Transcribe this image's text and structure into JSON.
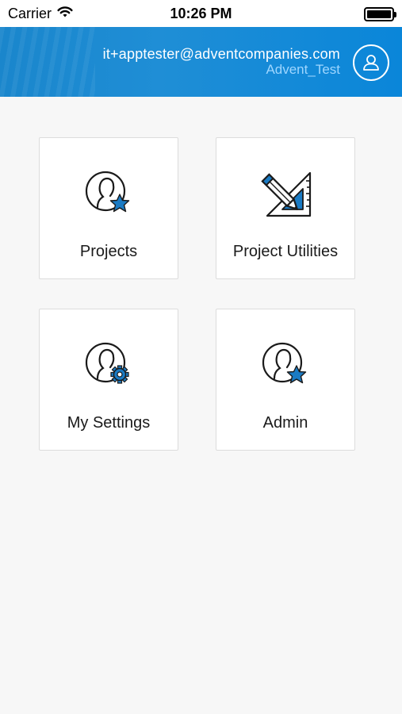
{
  "status_bar": {
    "carrier": "Carrier",
    "time": "10:26 PM"
  },
  "header": {
    "email": "it+apptester@adventcompanies.com",
    "environment": "Advent_Test"
  },
  "tiles": [
    {
      "label": "Projects",
      "icon": "user-star-icon"
    },
    {
      "label": "Project Utilities",
      "icon": "pencil-triangle-icon"
    },
    {
      "label": "My Settings",
      "icon": "user-gear-icon"
    },
    {
      "label": "Admin",
      "icon": "user-star-icon"
    }
  ],
  "colors": {
    "header_blue": "#1f8ed6",
    "accent_blue": "#1a7bc4",
    "env_text": "#9ed6ff"
  }
}
